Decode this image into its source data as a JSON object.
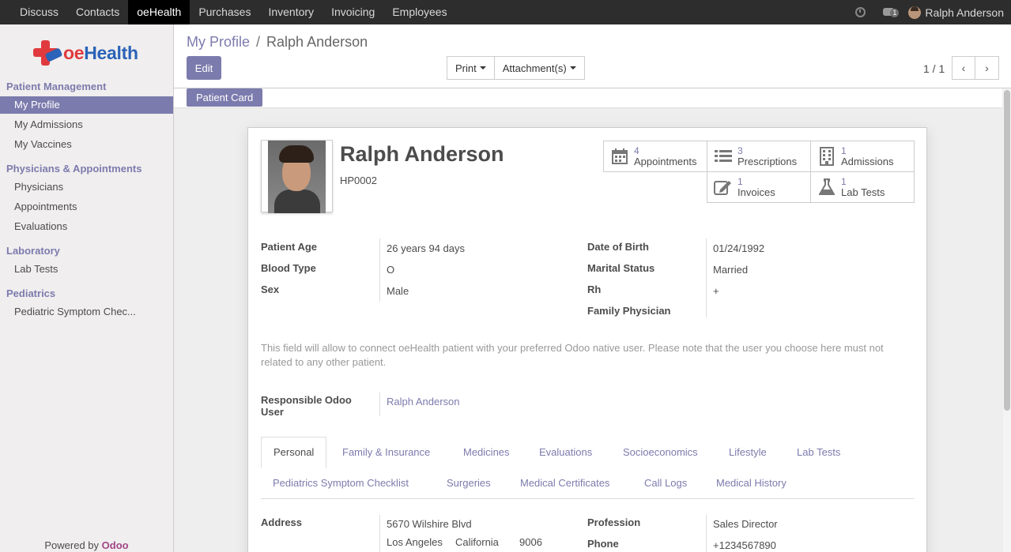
{
  "topbar": {
    "menu": [
      "Discuss",
      "Contacts",
      "oeHealth",
      "Purchases",
      "Inventory",
      "Invoicing",
      "Employees"
    ],
    "active_menu": "oeHealth",
    "chat_count": "1",
    "user_name": "Ralph Anderson"
  },
  "sidebar": {
    "logo_text_accent": "oe",
    "logo_text": "Health",
    "sections": [
      {
        "title": "Patient Management",
        "items": [
          "My Profile",
          "My Admissions",
          "My Vaccines"
        ]
      },
      {
        "title": "Physicians & Appointments",
        "items": [
          "Physicians",
          "Appointments",
          "Evaluations"
        ]
      },
      {
        "title": "Laboratory",
        "items": [
          "Lab Tests"
        ]
      },
      {
        "title": "Pediatrics",
        "items": [
          "Pediatric Symptom Chec..."
        ]
      }
    ],
    "active_item": "My Profile",
    "powered_prefix": "Powered by",
    "powered_brand": "Odoo"
  },
  "control": {
    "breadcrumb_link": "My Profile",
    "breadcrumb_sep": "/",
    "breadcrumb_current": "Ralph Anderson",
    "edit_label": "Edit",
    "print_label": "Print",
    "attachments_label": "Attachment(s)",
    "pager": "1 / 1",
    "prev_glyph": "‹",
    "next_glyph": "›"
  },
  "statusbar": {
    "patient_card_label": "Patient Card"
  },
  "patient": {
    "name": "Ralph Anderson",
    "code": "HP0002"
  },
  "smart_buttons": [
    {
      "count": "4",
      "label": "Appointments",
      "icon": "calendar-icon"
    },
    {
      "count": "3",
      "label": "Prescriptions",
      "icon": "list-icon"
    },
    {
      "count": "1",
      "label": "Admissions",
      "icon": "building-icon"
    },
    {
      "count": "1",
      "label": "Invoices",
      "icon": "edit-icon"
    },
    {
      "count": "1",
      "label": "Lab Tests",
      "icon": "flask-icon"
    }
  ],
  "fields": {
    "patient_age_label": "Patient Age",
    "patient_age": "26 years 94 days",
    "blood_type_label": "Blood Type",
    "blood_type": "O",
    "sex_label": "Sex",
    "sex": "Male",
    "dob_label": "Date of Birth",
    "dob": "01/24/1992",
    "marital_label": "Marital Status",
    "marital": "Married",
    "rh_label": "Rh",
    "rh": "+",
    "family_physician_label": "Family Physician",
    "family_physician": "",
    "help_text": "This field will allow to connect oeHealth patient with your preferred Odoo native user. Please note that the user you choose here must not related to any other patient.",
    "resp_user_label_1": "Responsible Odoo",
    "resp_user_label_2": "User",
    "resp_user": "Ralph Anderson"
  },
  "tabs": {
    "row1": [
      "Personal",
      "Family & Insurance",
      "Medicines",
      "Evaluations",
      "Socioeconomics",
      "Lifestyle",
      "Lab Tests"
    ],
    "row2": [
      "Pediatrics Symptom Checklist",
      "Surgeries",
      "Medical Certificates",
      "Call Logs",
      "Medical History"
    ],
    "active": "Personal"
  },
  "personal": {
    "address_label": "Address",
    "street": "5670 Wilshire Blvd",
    "city": "Los Angeles",
    "state": "California",
    "zip": "9006",
    "profession_label": "Profession",
    "profession": "Sales Director",
    "phone_label": "Phone",
    "phone": "+1234567890"
  }
}
